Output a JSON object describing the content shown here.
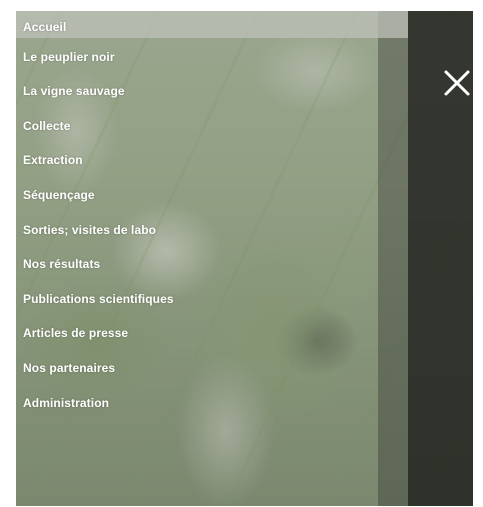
{
  "menu": {
    "items": [
      {
        "label": "Accueil",
        "active": true
      },
      {
        "label": "Le peuplier noir"
      },
      {
        "label": "La vigne sauvage"
      },
      {
        "label": "Collecte"
      },
      {
        "label": "Extraction"
      },
      {
        "label": "Séquençage"
      },
      {
        "label": "Sorties; visites de labo"
      },
      {
        "label": "Nos résultats"
      },
      {
        "label": "Publications scientifiques"
      },
      {
        "label": "Articles de presse"
      },
      {
        "label": "Nos partenaires"
      },
      {
        "label": "Administration"
      }
    ]
  },
  "icons": {
    "close": "close-icon"
  },
  "colors": {
    "menu_text": "#ffffff",
    "active_item_bg": "#bfc1b9",
    "overlay": "#232521"
  }
}
